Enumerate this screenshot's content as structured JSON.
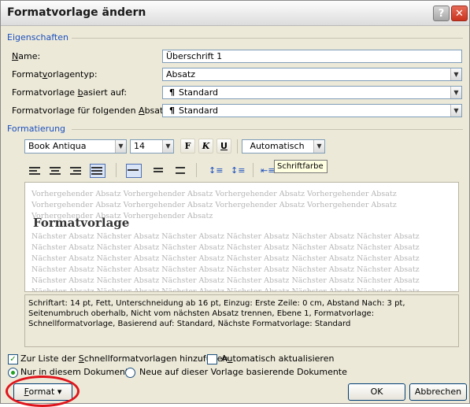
{
  "dialog": {
    "title": "Formatvorlage ändern",
    "help_glyph": "?",
    "close_glyph": "✕"
  },
  "eigenschaften": {
    "group_label": "Eigenschaften",
    "name": {
      "label_u": "N",
      "label_rest": "ame:",
      "value": "Überschrift 1"
    },
    "typ": {
      "label_pre": "Format",
      "label_u": "v",
      "label_rest": "orlagentyp:",
      "value": "Absatz"
    },
    "basiert": {
      "label_pre": "Formatvorlage ",
      "label_u": "b",
      "label_rest": "asiert auf:",
      "value": "Standard",
      "icon": "¶"
    },
    "folgend": {
      "label_pre": "Formatvorlage für folgenden ",
      "label_u": "A",
      "label_rest": "bsatz:",
      "value": "Standard",
      "icon": "¶"
    }
  },
  "formatierung": {
    "group_label": "Formatierung",
    "font": "Book Antiqua",
    "size": "14",
    "bold_label": "F",
    "italic_label": "K",
    "underline_label": "U",
    "color": "Automatisch",
    "tooltip": "Schriftfarbe"
  },
  "preview": {
    "before": "Vorhergehender Absatz Vorhergehender Absatz Vorhergehender Absatz Vorhergehender Absatz Vorhergehender Absatz Vorhergehender Absatz Vorhergehender Absatz Vorhergehender Absatz Vorhergehender Absatz Vorhergehender Absatz",
    "sample": "Formatvorlage",
    "after": "Nächster Absatz Nächster Absatz Nächster Absatz Nächster Absatz Nächster Absatz Nächster Absatz Nächster Absatz Nächster Absatz Nächster Absatz Nächster Absatz Nächster Absatz Nächster Absatz Nächster Absatz Nächster Absatz Nächster Absatz Nächster Absatz Nächster Absatz Nächster Absatz Nächster Absatz Nächster Absatz Nächster Absatz Nächster Absatz Nächster Absatz Nächster Absatz Nächster Absatz Nächster Absatz Nächster Absatz Nächster Absatz Nächster Absatz Nächster Absatz Nächster Absatz Nächster Absatz Nächster Absatz Nächster Absatz Nächster Absatz Nächster Absatz Nächster Absatz Nächster Absatz Nächster Absatz Nächster Absatz Nächster Absatz Nächster Absatz Nächster Absatz Nächster Absatz Nächster Absatz"
  },
  "description": "Schriftart: 14 pt, Fett, Unterschneidung ab 16 pt, Einzug: Erste Zeile: 0 cm, Abstand Nach: 3 pt, Seitenumbruch oberhalb, Nicht vom nächsten Absatz trennen, Ebene 1, Formatvorlage: Schnellformatvorlage, Basierend auf: Standard, Nächste Formatvorlage: Standard",
  "options": {
    "add_to_list": {
      "pre": "Zur Liste der ",
      "u": "S",
      "rest": "chnellformatvorlagen hinzufügen",
      "checked": true
    },
    "auto_update": {
      "pre": "A",
      "u": "u",
      "rest": "tomatisch aktualisieren",
      "checked": false
    },
    "only_doc": {
      "pre": "Nur ",
      "u": "i",
      "rest": "n diesem Dokument",
      "selected": true
    },
    "new_docs": {
      "label": "Neue auf dieser Vorlage basierende Dokumente",
      "selected": false
    }
  },
  "buttons": {
    "format_u": "F",
    "format_rest": "ormat",
    "format_arrow": "▾",
    "ok": "OK",
    "cancel": "Abbrechen"
  },
  "colors": {
    "group_label": "#1b4fbe",
    "highlight_circle": "#e0141b"
  }
}
